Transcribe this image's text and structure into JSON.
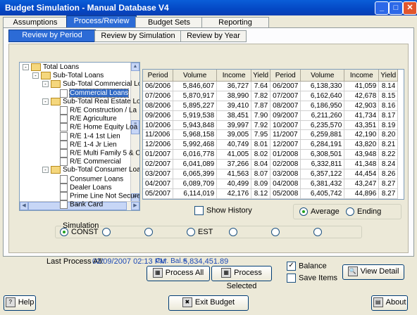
{
  "window": {
    "title": "Budget Simulation - Manual Database V4"
  },
  "tabs": [
    "Assumptions",
    "Process/Review",
    "Budget Sets",
    "Reporting"
  ],
  "subtabs": [
    "Review by Period",
    "Review by Simulation",
    "Review by Year"
  ],
  "tree": [
    {
      "label": "Total Loans",
      "level": 0,
      "kind": "folder",
      "exp": "-"
    },
    {
      "label": "Sub-Total Loans",
      "level": 1,
      "kind": "folder",
      "exp": "-"
    },
    {
      "label": "Sub-Total Commercial Loa",
      "level": 2,
      "kind": "folder",
      "exp": "-"
    },
    {
      "label": "Commercial Loans",
      "level": 3,
      "kind": "leaf",
      "selected": true
    },
    {
      "label": "Sub-Total Real Estate Loa",
      "level": 2,
      "kind": "folder",
      "exp": "-"
    },
    {
      "label": "R/E Construction / La",
      "level": 3,
      "kind": "leaf"
    },
    {
      "label": "R/E Agriculture",
      "level": 3,
      "kind": "leaf"
    },
    {
      "label": "R/E Home Equity Loa",
      "level": 3,
      "kind": "leaf"
    },
    {
      "label": "R/E 1-4 1st Lien",
      "level": 3,
      "kind": "leaf"
    },
    {
      "label": "R/E 1-4 Jr Lien",
      "level": 3,
      "kind": "leaf"
    },
    {
      "label": "R/E Multi Family 5 & C",
      "level": 3,
      "kind": "leaf"
    },
    {
      "label": "R/E Commercial",
      "level": 3,
      "kind": "leaf"
    },
    {
      "label": "Sub-Total Consumer Loar",
      "level": 2,
      "kind": "folder",
      "exp": "-"
    },
    {
      "label": "Consumer Loans",
      "level": 3,
      "kind": "leaf"
    },
    {
      "label": "Dealer Loans",
      "level": 3,
      "kind": "leaf"
    },
    {
      "label": "Prime Line Not Secure",
      "level": 3,
      "kind": "leaf"
    },
    {
      "label": "Bank Card",
      "level": 3,
      "kind": "leaf"
    }
  ],
  "grid": {
    "headers": [
      "Period",
      "Volume",
      "Income",
      "Yield",
      "Period",
      "Volume",
      "Income",
      "Yield"
    ],
    "rows": [
      [
        "06/2006",
        "5,846,607",
        "36,727",
        "7.64",
        "06/2007",
        "6,138,330",
        "41,059",
        "8.14"
      ],
      [
        "07/2006",
        "5,870,917",
        "38,990",
        "7.82",
        "07/2007",
        "6,162,640",
        "42,678",
        "8.15"
      ],
      [
        "08/2006",
        "5,895,227",
        "39,410",
        "7.87",
        "08/2007",
        "6,186,950",
        "42,903",
        "8.16"
      ],
      [
        "09/2006",
        "5,919,538",
        "38,451",
        "7.90",
        "09/2007",
        "6,211,260",
        "41,734",
        "8.17"
      ],
      [
        "10/2006",
        "5,943,848",
        "39,997",
        "7.92",
        "10/2007",
        "6,235,570",
        "43,351",
        "8.19"
      ],
      [
        "11/2006",
        "5,968,158",
        "39,005",
        "7.95",
        "11/2007",
        "6,259,881",
        "42,190",
        "8.20"
      ],
      [
        "12/2006",
        "5,992,468",
        "40,749",
        "8.01",
        "12/2007",
        "6,284,191",
        "43,820",
        "8.21"
      ],
      [
        "01/2007",
        "6,016,778",
        "41,005",
        "8.02",
        "01/2008",
        "6,308,501",
        "43,948",
        "8.22"
      ],
      [
        "02/2007",
        "6,041,089",
        "37,266",
        "8.04",
        "02/2008",
        "6,332,811",
        "41,348",
        "8.24"
      ],
      [
        "03/2007",
        "6,065,399",
        "41,563",
        "8.07",
        "03/2008",
        "6,357,122",
        "44,454",
        "8.26"
      ],
      [
        "04/2007",
        "6,089,709",
        "40,499",
        "8.09",
        "04/2008",
        "6,381,432",
        "43,247",
        "8.27"
      ],
      [
        "05/2007",
        "6,114,019",
        "42,176",
        "8.12",
        "05/2008",
        "6,405,742",
        "44,896",
        "8.27"
      ]
    ]
  },
  "show_history_label": "Show History",
  "average_label": "Average",
  "ending_label": "Ending",
  "simulation": {
    "title": "Simulation",
    "options": [
      "CONST",
      "",
      "",
      "EST",
      "",
      "",
      ""
    ]
  },
  "status": {
    "last_process_label": "Last Process All:",
    "last_process_value": "02/09/2007 02:13 PM",
    "cur_bal_label": "Cur. Bal.=",
    "cur_bal_value": "5,834,451.89"
  },
  "buttons": {
    "process_all": "Process All",
    "process_selected": "Process Selected",
    "balance": "Balance",
    "save_items": "Save Items",
    "view_detail": "View Detail",
    "help": "Help",
    "exit_budget": "Exit Budget",
    "about": "About"
  },
  "colors": {
    "accent": "#2c6bd6",
    "title_bar": "#0a5ed8",
    "face": "#ece9d8"
  }
}
